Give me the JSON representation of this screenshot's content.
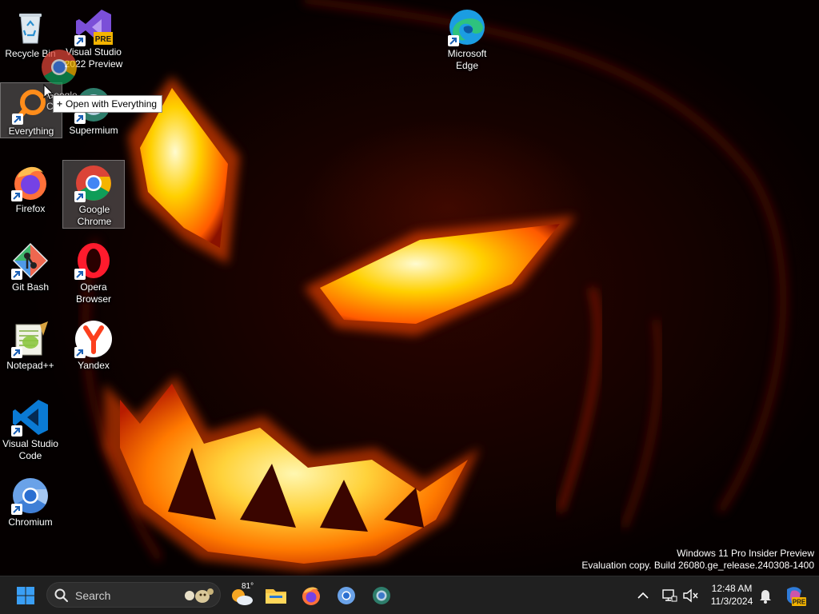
{
  "desktop": {
    "icons": [
      {
        "label": "Recycle Bin"
      },
      {
        "label": "Visual Studio 2022 Preview",
        "badge": "PRE"
      },
      {
        "label": "Everything"
      },
      {
        "label": "Supermium"
      },
      {
        "label": "Firefox"
      },
      {
        "label": "Google Chrome"
      },
      {
        "label": "Git Bash"
      },
      {
        "label": "Opera Browser"
      },
      {
        "label": "Notepad++"
      },
      {
        "label": "Yandex"
      },
      {
        "label": "Visual Studio Code"
      },
      {
        "label": "Chromium"
      },
      {
        "label": "Microsoft Edge"
      }
    ],
    "drag_ghost_label": "Google Ch",
    "tooltip": {
      "symbol": "+",
      "text": "Open with Everything"
    }
  },
  "watermark": {
    "line1": "Windows 11 Pro Insider Preview",
    "line2": "Evaluation copy. Build 26080.ge_release.240308-1400"
  },
  "taskbar": {
    "search_placeholder": "Search",
    "weather_temp": "81°",
    "time": "12:48 AM",
    "date": "11/3/2024",
    "copilot_badge": "PRE",
    "colors": {
      "background": "#202020",
      "accent": "#0078d4"
    }
  }
}
